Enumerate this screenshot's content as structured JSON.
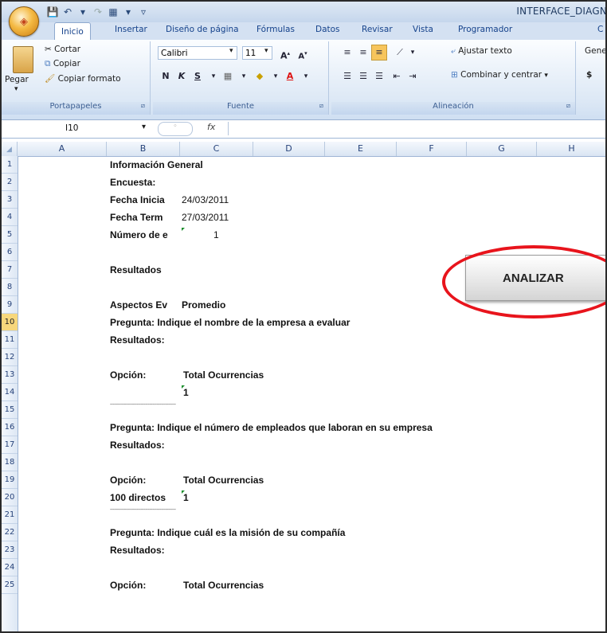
{
  "window": {
    "title": "INTERFACE_DIAGN",
    "office_logo": "office-logo"
  },
  "ribbon_tabs": [
    "Inicio",
    "Insertar",
    "Diseño de página",
    "Fórmulas",
    "Datos",
    "Revisar",
    "Vista",
    "Programador",
    "C"
  ],
  "clipboard": {
    "paste": "Pegar",
    "cut": "Cortar",
    "copy": "Copiar",
    "format_painter": "Copiar formato",
    "group": "Portapapeles"
  },
  "font": {
    "name": "Calibri",
    "size": "11",
    "bold": "N",
    "italic": "K",
    "underline": "S",
    "group": "Fuente"
  },
  "alignment": {
    "wrap": "Ajustar texto",
    "merge": "Combinar y centrar",
    "group": "Alineación"
  },
  "number": {
    "format": "Gene",
    "currency": "$"
  },
  "formula_bar": {
    "name_box": "I10",
    "fx": "fx"
  },
  "columns": [
    "A",
    "B",
    "C",
    "D",
    "E",
    "F",
    "G",
    "H"
  ],
  "rows": [
    "1",
    "2",
    "3",
    "4",
    "5",
    "6",
    "7",
    "8",
    "9",
    "10",
    "11",
    "12",
    "13",
    "14",
    "15",
    "16",
    "17",
    "18",
    "19",
    "20",
    "21",
    "22",
    "23",
    "24",
    "25"
  ],
  "cells": {
    "r1": "Información General",
    "r2": "Encuesta:",
    "r3b": "Fecha Inicia",
    "r3c": "24/03/2011",
    "r4b": "Fecha Term",
    "r4c": "27/03/2011",
    "r5b": "Número de e",
    "r5c": "1",
    "r7": "Resultados",
    "r9b": "Aspectos Ev",
    "r9c": "Promedio",
    "r10": "Pregunta: Indique el nombre de la empresa a evaluar",
    "r11": "Resultados:",
    "r13b": "Opción:",
    "r13c": "Total Ocurrencias",
    "r14c": "1",
    "r15": "---------------------------------------------",
    "r16": "Pregunta: Indique el número de empleados que laboran en su empresa",
    "r17": "Resultados:",
    "r19b": "Opción:",
    "r19c": "Total Ocurrencias",
    "r20b": "100 directos",
    "r20c": "1",
    "r21": "---------------------------------------------",
    "r22": "Pregunta: Indique cuál es la misión de su compañía",
    "r23": "Resultados:",
    "r25b": "Opción:",
    "r25c": "Total Ocurrencias"
  },
  "button": {
    "label": "ANALIZAR"
  },
  "highlight_color": "#e8141c"
}
